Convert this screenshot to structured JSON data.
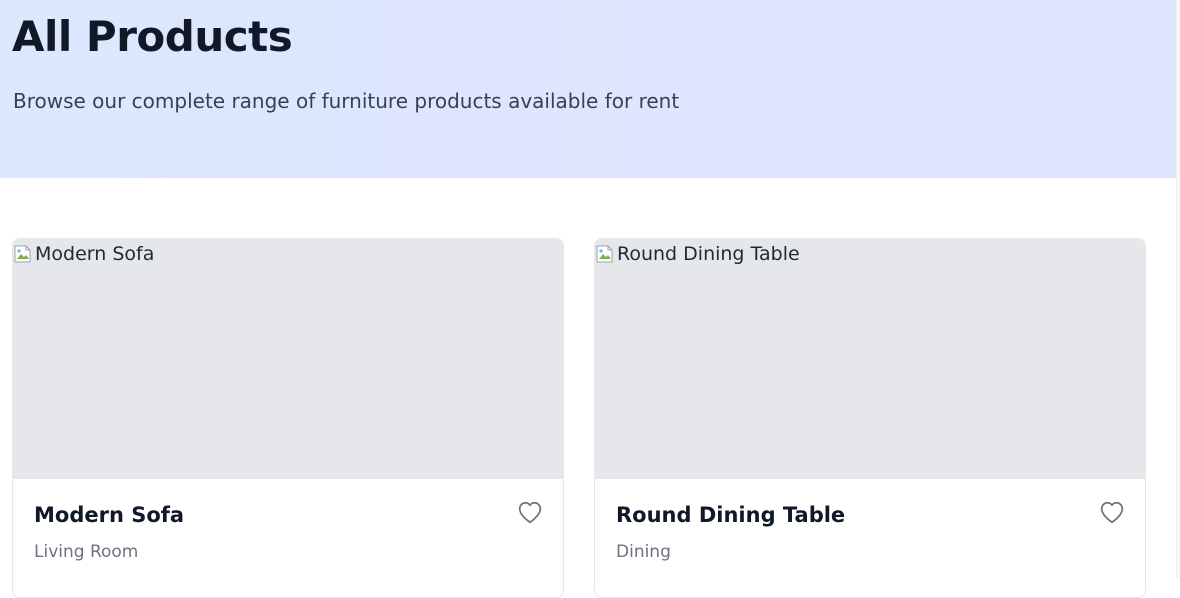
{
  "hero": {
    "title": "All Products",
    "subtitle": "Browse our complete range of furniture products available for rent"
  },
  "products": [
    {
      "image_alt": "Modern Sofa",
      "name": "Modern Sofa",
      "category": "Living Room",
      "favorite_icon": "heart-outline-icon"
    },
    {
      "image_alt": "Round Dining Table",
      "name": "Round Dining Table",
      "category": "Dining",
      "favorite_icon": "heart-outline-icon"
    }
  ],
  "colors": {
    "hero_bg_start": "#dbe8fe",
    "hero_bg_end": "#e0e5ff",
    "image_placeholder": "#e5e7eb",
    "title_text": "#111827",
    "muted_text": "#6b7280",
    "icon": "#6b7280"
  }
}
